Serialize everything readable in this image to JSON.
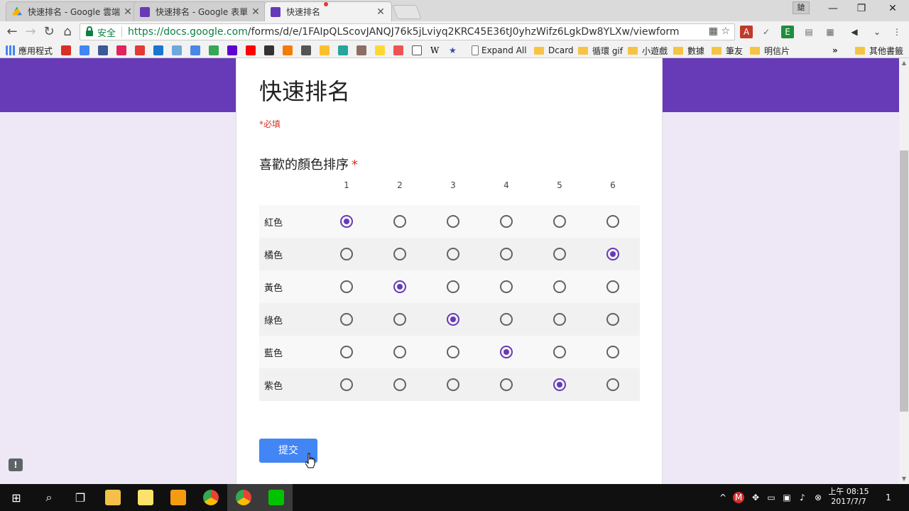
{
  "browser": {
    "tabs": [
      {
        "label": "快速排名 - Google 雲端",
        "icon": "google-drive-icon"
      },
      {
        "label": "快速排名 - Google 表單",
        "icon": "google-forms-icon"
      },
      {
        "label": "快速排名",
        "icon": "google-forms-icon",
        "active": true
      }
    ],
    "profile_label": "鎗",
    "secure_label": "安全",
    "url_host": "https://docs.google.com",
    "url_path": "/forms/d/e/1FAIpQLScovJANQJ76k5jLviyq2KRC45E36tJ0yhzWifz6LgkDw8YLXw/viewform",
    "bookmarks": [
      {
        "label": "應用程式",
        "icon": "apps-grid-icon"
      },
      {
        "label": "Expand All",
        "icon": "page-icon"
      },
      {
        "label": "Dcard",
        "icon": "folder-icon"
      },
      {
        "label": "循環 gif",
        "icon": "folder-icon"
      },
      {
        "label": "小遊戲",
        "icon": "folder-icon"
      },
      {
        "label": "數據",
        "icon": "folder-icon"
      },
      {
        "label": "筆友",
        "icon": "folder-icon"
      },
      {
        "label": "明信片",
        "icon": "folder-icon"
      },
      {
        "label": "其他書籤",
        "icon": "folder-icon"
      }
    ]
  },
  "form": {
    "title": "快速排名",
    "required_note": "*必填",
    "question": "喜歡的顏色排序",
    "required_star": "*",
    "columns": [
      "1",
      "2",
      "3",
      "4",
      "5",
      "6"
    ],
    "rows": [
      {
        "label": "紅色",
        "selected": 1
      },
      {
        "label": "橘色",
        "selected": 6
      },
      {
        "label": "黃色",
        "selected": 2
      },
      {
        "label": "綠色",
        "selected": 3
      },
      {
        "label": "藍色",
        "selected": 4
      },
      {
        "label": "紫色",
        "selected": 5
      }
    ],
    "submit_label": "提交",
    "accent_color": "#673ab7",
    "button_color": "#4285f4"
  },
  "feedback_label": "!",
  "taskbar": {
    "time": "上午 08:15",
    "date": "2017/7/7",
    "notification_count": "1"
  }
}
